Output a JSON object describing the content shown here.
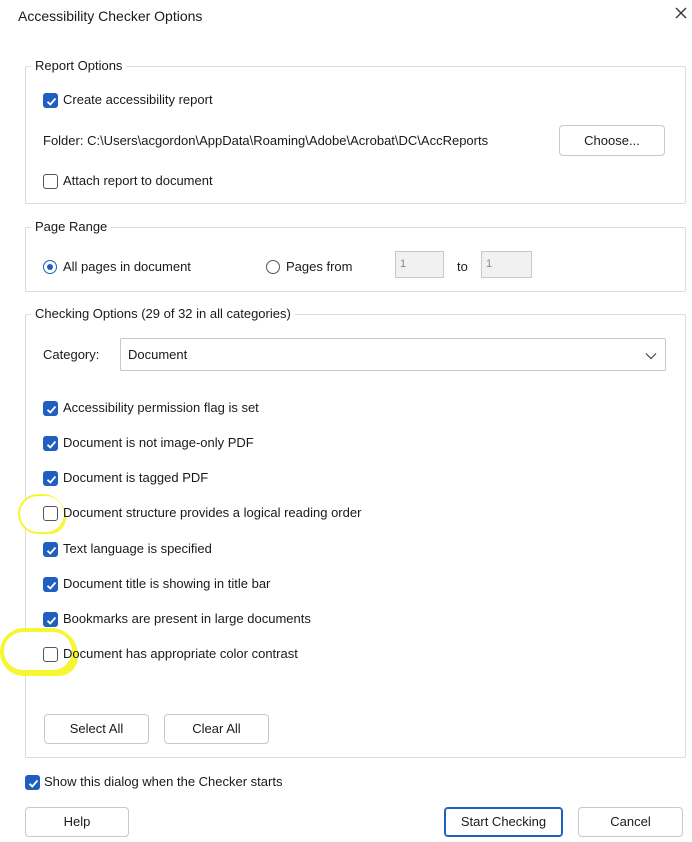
{
  "dialog": {
    "title": "Accessibility Checker Options"
  },
  "report_options": {
    "legend": "Report Options",
    "create_report": {
      "label": "Create accessibility report",
      "checked": true
    },
    "folder_label": "Folder: C:\\Users\\acgordon\\AppData\\Roaming\\Adobe\\Acrobat\\DC\\AccReports",
    "choose_button": "Choose...",
    "attach_report": {
      "label": "Attach report to document",
      "checked": false
    }
  },
  "page_range": {
    "legend": "Page Range",
    "all_pages": {
      "label": "All pages in document",
      "selected": true
    },
    "pages_from": {
      "label": "Pages from",
      "selected": false
    },
    "from_value": "1",
    "to_label": "to",
    "to_value": "1"
  },
  "checking_options": {
    "legend": "Checking Options (29 of 32 in all categories)",
    "category_label": "Category:",
    "category_value": "Document",
    "items": [
      {
        "label": "Accessibility permission flag is set",
        "checked": true
      },
      {
        "label": "Document is not image-only PDF",
        "checked": true
      },
      {
        "label": "Document is tagged PDF",
        "checked": true
      },
      {
        "label": "Document structure provides a logical reading order",
        "checked": false
      },
      {
        "label": "Text language is specified",
        "checked": true
      },
      {
        "label": "Document title is showing in title bar",
        "checked": true
      },
      {
        "label": "Bookmarks are present in large documents",
        "checked": true
      },
      {
        "label": "Document has appropriate color contrast",
        "checked": false
      }
    ],
    "select_all": "Select All",
    "clear_all": "Clear All"
  },
  "show_dialog": {
    "label": "Show this dialog when the Checker starts",
    "checked": true
  },
  "footer": {
    "help": "Help",
    "start_checking": "Start Checking",
    "cancel": "Cancel"
  },
  "colors": {
    "accent": "#1f5fbf",
    "highlight": "#f4f400"
  },
  "icons": [
    "close-icon",
    "checkmark-icon",
    "chevron-down-icon"
  ]
}
